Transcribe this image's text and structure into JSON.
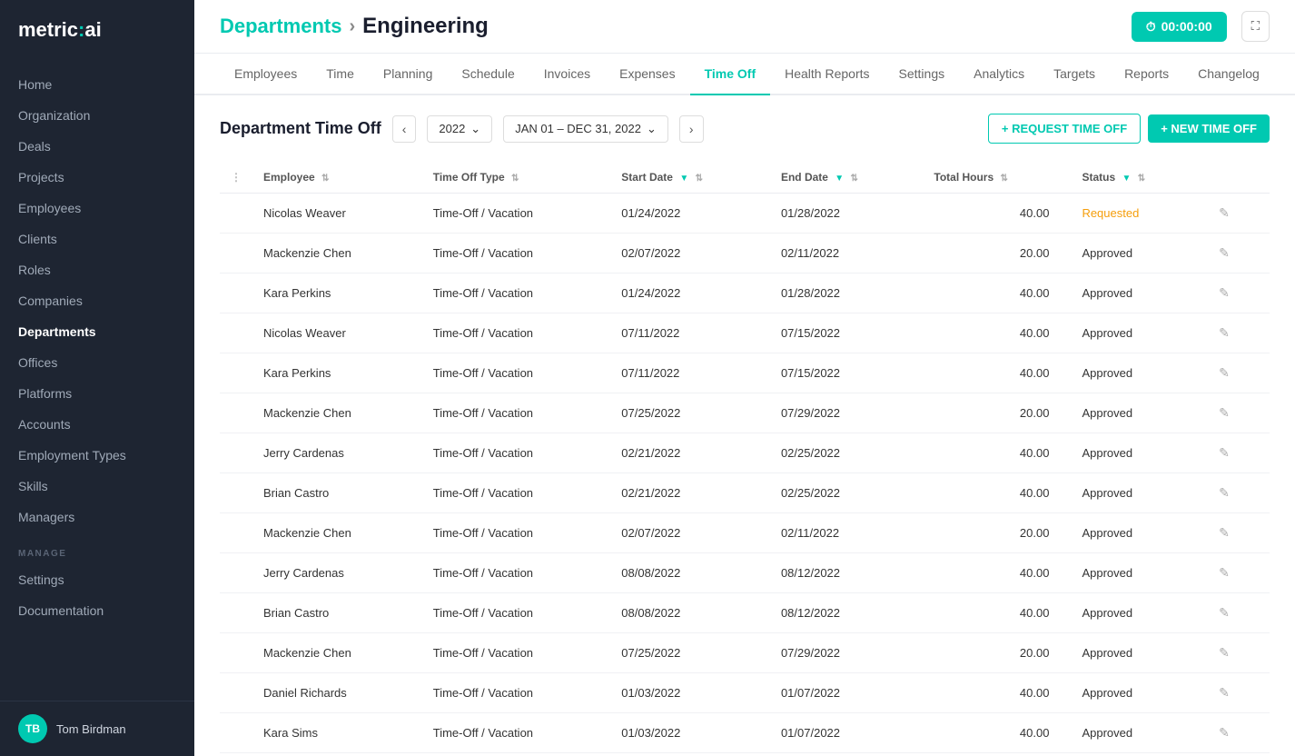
{
  "logo": {
    "text_before": "metric",
    "colon": ":",
    "text_after": "ai"
  },
  "sidebar": {
    "items": [
      {
        "label": "Home",
        "active": false
      },
      {
        "label": "Organization",
        "active": false
      },
      {
        "label": "Deals",
        "active": false
      },
      {
        "label": "Projects",
        "active": false
      },
      {
        "label": "Employees",
        "active": false
      },
      {
        "label": "Clients",
        "active": false
      },
      {
        "label": "Roles",
        "active": false
      },
      {
        "label": "Companies",
        "active": false
      },
      {
        "label": "Departments",
        "active": true
      },
      {
        "label": "Offices",
        "active": false
      },
      {
        "label": "Platforms",
        "active": false
      },
      {
        "label": "Accounts",
        "active": false
      },
      {
        "label": "Employment Types",
        "active": false
      },
      {
        "label": "Skills",
        "active": false
      },
      {
        "label": "Managers",
        "active": false
      }
    ],
    "manage_label": "MANAGE",
    "manage_items": [
      {
        "label": "Settings",
        "active": false
      },
      {
        "label": "Documentation",
        "active": false
      }
    ],
    "user": {
      "initials": "TB",
      "name": "Tom Birdman"
    }
  },
  "breadcrumb": {
    "parent": "Departments",
    "separator": "›",
    "current": "Engineering"
  },
  "timer": {
    "label": "00:00:00"
  },
  "tabs": [
    {
      "label": "Employees",
      "active": false
    },
    {
      "label": "Time",
      "active": false
    },
    {
      "label": "Planning",
      "active": false
    },
    {
      "label": "Schedule",
      "active": false
    },
    {
      "label": "Invoices",
      "active": false
    },
    {
      "label": "Expenses",
      "active": false
    },
    {
      "label": "Time Off",
      "active": true
    },
    {
      "label": "Health Reports",
      "active": false
    },
    {
      "label": "Settings",
      "active": false
    },
    {
      "label": "Analytics",
      "active": false
    },
    {
      "label": "Targets",
      "active": false
    },
    {
      "label": "Reports",
      "active": false
    },
    {
      "label": "Changelog",
      "active": false
    }
  ],
  "timeoff": {
    "title": "Department Time Off",
    "year": "2022",
    "date_range": "JAN 01 – DEC 31, 2022",
    "btn_request": "+ REQUEST TIME OFF",
    "btn_new": "+ NEW TIME OFF"
  },
  "table": {
    "columns": [
      {
        "label": "Employee"
      },
      {
        "label": "Time Off Type"
      },
      {
        "label": "Start Date"
      },
      {
        "label": "End Date"
      },
      {
        "label": "Total Hours"
      },
      {
        "label": "Status"
      }
    ],
    "rows": [
      {
        "employee": "Nicolas Weaver",
        "type": "Time-Off / Vacation",
        "start": "01/24/2022",
        "end": "01/28/2022",
        "hours": "40.00",
        "status": "Requested",
        "status_class": "status-requested"
      },
      {
        "employee": "Mackenzie Chen",
        "type": "Time-Off / Vacation",
        "start": "02/07/2022",
        "end": "02/11/2022",
        "hours": "20.00",
        "status": "Approved",
        "status_class": "status-approved"
      },
      {
        "employee": "Kara Perkins",
        "type": "Time-Off / Vacation",
        "start": "01/24/2022",
        "end": "01/28/2022",
        "hours": "40.00",
        "status": "Approved",
        "status_class": "status-approved"
      },
      {
        "employee": "Nicolas Weaver",
        "type": "Time-Off / Vacation",
        "start": "07/11/2022",
        "end": "07/15/2022",
        "hours": "40.00",
        "status": "Approved",
        "status_class": "status-approved"
      },
      {
        "employee": "Kara Perkins",
        "type": "Time-Off / Vacation",
        "start": "07/11/2022",
        "end": "07/15/2022",
        "hours": "40.00",
        "status": "Approved",
        "status_class": "status-approved"
      },
      {
        "employee": "Mackenzie Chen",
        "type": "Time-Off / Vacation",
        "start": "07/25/2022",
        "end": "07/29/2022",
        "hours": "20.00",
        "status": "Approved",
        "status_class": "status-approved"
      },
      {
        "employee": "Jerry Cardenas",
        "type": "Time-Off / Vacation",
        "start": "02/21/2022",
        "end": "02/25/2022",
        "hours": "40.00",
        "status": "Approved",
        "status_class": "status-approved"
      },
      {
        "employee": "Brian Castro",
        "type": "Time-Off / Vacation",
        "start": "02/21/2022",
        "end": "02/25/2022",
        "hours": "40.00",
        "status": "Approved",
        "status_class": "status-approved"
      },
      {
        "employee": "Mackenzie Chen",
        "type": "Time-Off / Vacation",
        "start": "02/07/2022",
        "end": "02/11/2022",
        "hours": "20.00",
        "status": "Approved",
        "status_class": "status-approved"
      },
      {
        "employee": "Jerry Cardenas",
        "type": "Time-Off / Vacation",
        "start": "08/08/2022",
        "end": "08/12/2022",
        "hours": "40.00",
        "status": "Approved",
        "status_class": "status-approved"
      },
      {
        "employee": "Brian Castro",
        "type": "Time-Off / Vacation",
        "start": "08/08/2022",
        "end": "08/12/2022",
        "hours": "40.00",
        "status": "Approved",
        "status_class": "status-approved"
      },
      {
        "employee": "Mackenzie Chen",
        "type": "Time-Off / Vacation",
        "start": "07/25/2022",
        "end": "07/29/2022",
        "hours": "20.00",
        "status": "Approved",
        "status_class": "status-approved"
      },
      {
        "employee": "Daniel Richards",
        "type": "Time-Off / Vacation",
        "start": "01/03/2022",
        "end": "01/07/2022",
        "hours": "40.00",
        "status": "Approved",
        "status_class": "status-approved"
      },
      {
        "employee": "Kara Sims",
        "type": "Time-Off / Vacation",
        "start": "01/03/2022",
        "end": "01/07/2022",
        "hours": "40.00",
        "status": "Approved",
        "status_class": "status-approved"
      }
    ]
  }
}
